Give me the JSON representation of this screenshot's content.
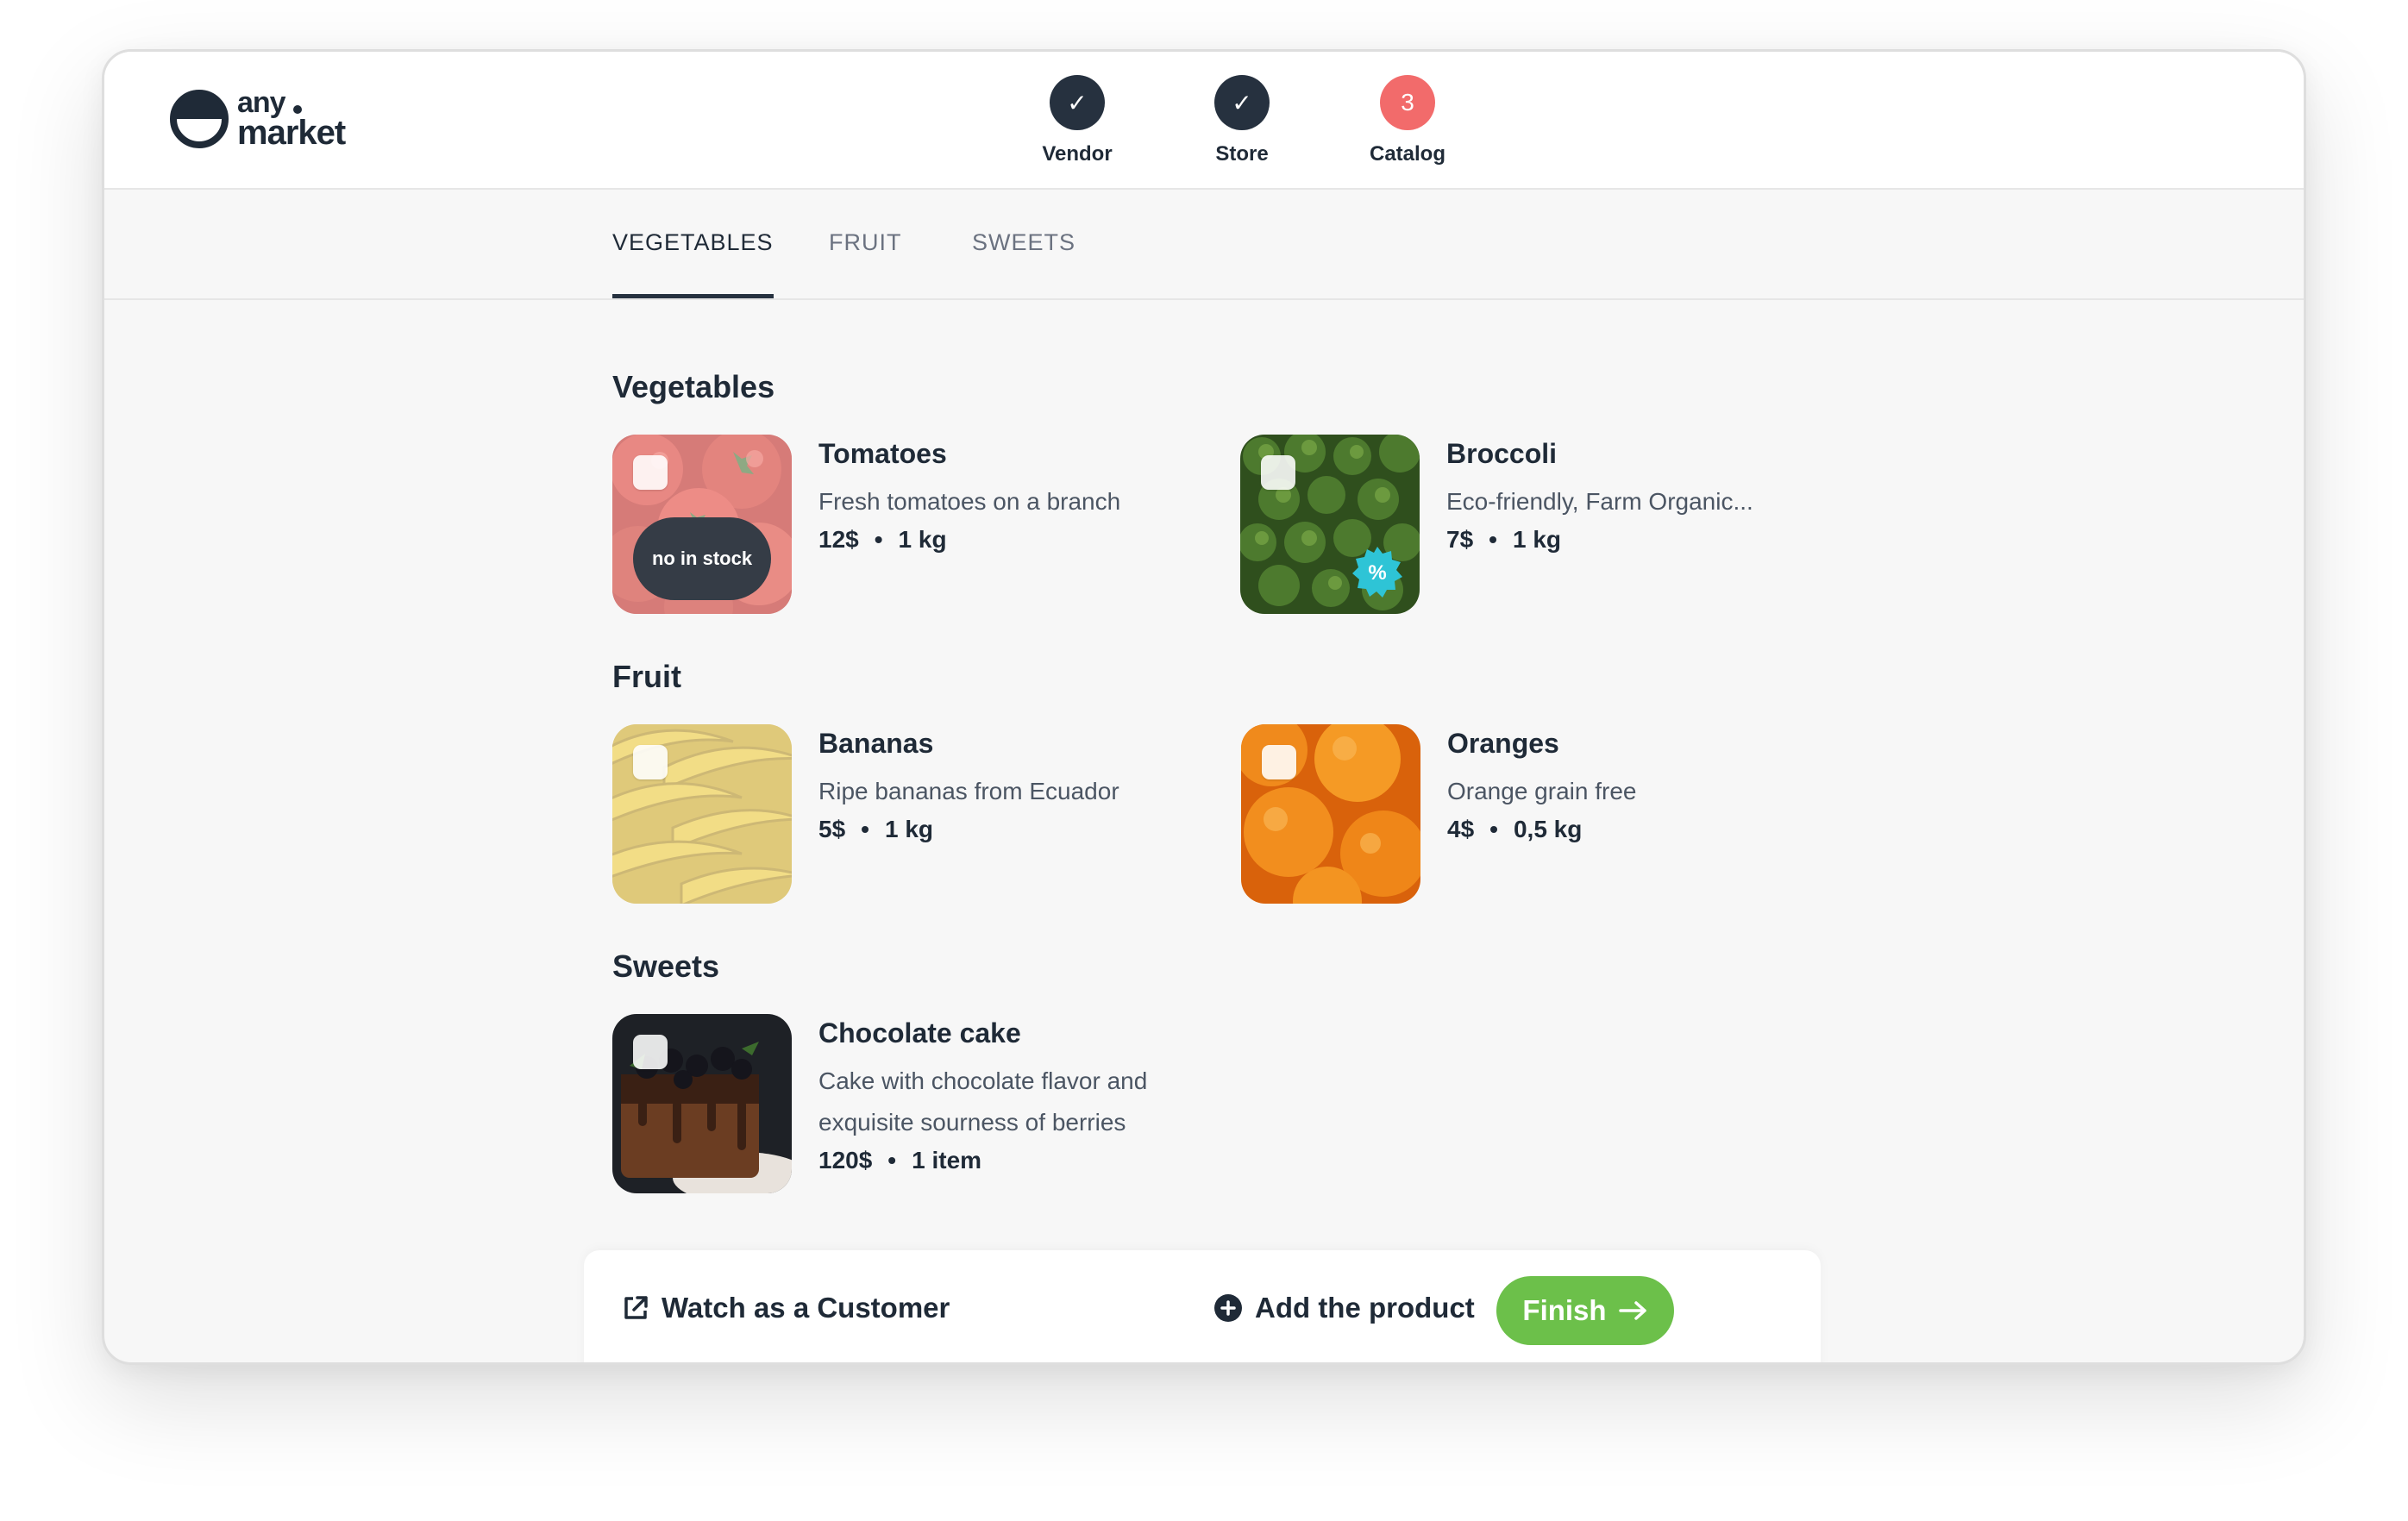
{
  "brand": {
    "line1": "any",
    "line2": "market"
  },
  "steps": [
    {
      "label": "Vendor",
      "state": "done",
      "mark": "✓"
    },
    {
      "label": "Store",
      "state": "done",
      "mark": "✓"
    },
    {
      "label": "Catalog",
      "state": "active",
      "mark": "3"
    }
  ],
  "tabs": [
    {
      "label": "VEGETABLES",
      "active": true
    },
    {
      "label": "FRUIT",
      "active": false
    },
    {
      "label": "SWEETS",
      "active": false
    }
  ],
  "sections": {
    "vegetables": {
      "title": "Vegetables",
      "items": [
        {
          "name": "Tomatoes",
          "desc": "Fresh tomatoes on a branch",
          "price": "12$",
          "unit": "1 kg",
          "badge": "no in stock",
          "image": "tomatoes"
        },
        {
          "name": "Broccoli",
          "desc": "Eco-friendly, Farm Organic...",
          "price": "7$",
          "unit": "1 kg",
          "badge_icon": "discount-percent-icon",
          "image": "broccoli"
        }
      ]
    },
    "fruit": {
      "title": "Fruit",
      "items": [
        {
          "name": "Bananas",
          "desc": "Ripe bananas from Ecuador",
          "price": "5$",
          "unit": "1 kg",
          "image": "bananas"
        },
        {
          "name": "Oranges",
          "desc": "Orange grain free",
          "price": "4$",
          "unit": "0,5 kg",
          "image": "oranges"
        }
      ]
    },
    "sweets": {
      "title": "Sweets",
      "items": [
        {
          "name": "Chocolate cake",
          "desc": "Cake with chocolate flavor and exquisite sourness of berries",
          "price": "120$",
          "unit": "1 item",
          "image": "chocolate-cake"
        }
      ]
    }
  },
  "separator": "•",
  "footer": {
    "watch_label": "Watch as a Customer",
    "add_label": "Add the product",
    "finish_label": "Finish"
  },
  "colors": {
    "accent_green": "#6cc04a",
    "step_done": "#26313f",
    "step_active": "#f26b6b",
    "discount_badge": "#2ec4d6"
  }
}
